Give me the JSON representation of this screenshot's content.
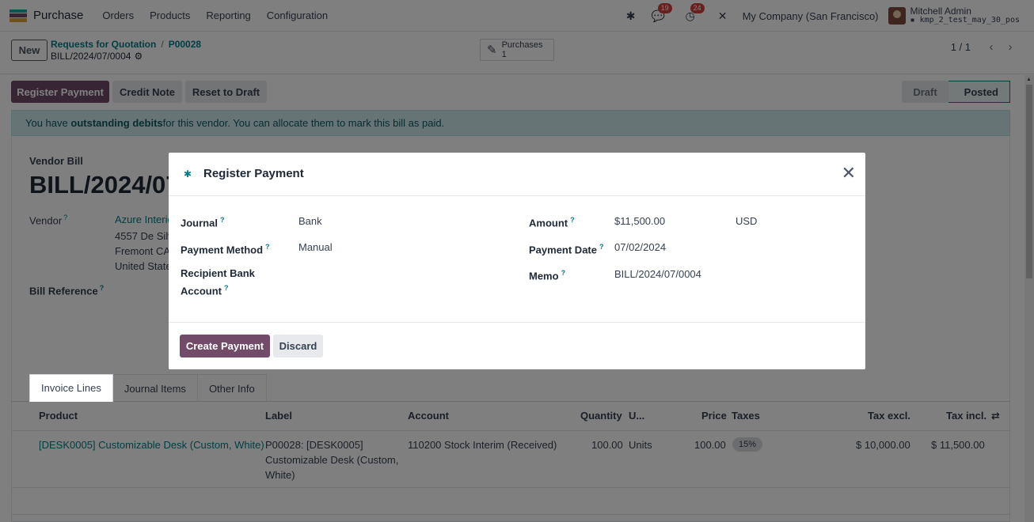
{
  "topbar": {
    "app_name": "Purchase",
    "menu": [
      "Orders",
      "Products",
      "Reporting",
      "Configuration"
    ],
    "icons": [
      "bug-icon",
      "chat-icon",
      "clock-icon",
      "tools-icon"
    ],
    "chat_count": "19",
    "activity_count": "24",
    "company": "My Company (San Francisco)",
    "user_name": "Mitchell Admin",
    "database": "kmp_2_test_may_30_pos"
  },
  "control_panel": {
    "new_label": "New",
    "breadcrumb": [
      "Requests for Quotation",
      "P00028"
    ],
    "current_record": "BILL/2024/07/0004",
    "smart_button": {
      "label": "Purchases",
      "count": "1"
    },
    "pager": "1 / 1"
  },
  "status_bar": {
    "buttons": [
      "Register Payment",
      "Credit Note",
      "Reset to Draft"
    ],
    "stages": [
      "Draft",
      "Posted"
    ],
    "active_stage": "Posted"
  },
  "alert": {
    "prefix": "You have ",
    "bold": "outstanding debits",
    "suffix": " for this vendor. You can allocate them to mark this bill as paid."
  },
  "form": {
    "type_label": "Vendor Bill",
    "name": "BILL/2024/07/0004",
    "vendor_label": "Vendor",
    "vendor_name": "Azure Interior",
    "vendor_address": [
      "4557 De Silva St",
      "Fremont CA 94538",
      "United States"
    ],
    "bill_reference_label": "Bill Reference"
  },
  "tabs": [
    "Invoice Lines",
    "Journal Items",
    "Other Info"
  ],
  "lines": {
    "columns": [
      "Product",
      "Label",
      "Account",
      "Quantity",
      "U...",
      "Price",
      "Taxes",
      "Tax excl.",
      "Tax incl."
    ],
    "rows": [
      {
        "product": "[DESK0005] Customizable Desk (Custom, White)",
        "label": [
          "P00028: [DESK0005]",
          "Customizable Desk (Custom,",
          "White)"
        ],
        "account": "110200 Stock Interim (Received)",
        "quantity": "100.00",
        "uom": "Units",
        "price": "100.00",
        "taxes": "15%",
        "tax_excl": "$ 10,000.00",
        "tax_incl": "$ 11,500.00"
      }
    ]
  },
  "modal": {
    "title": "Register Payment",
    "fields": {
      "journal": {
        "label": "Journal",
        "value": "Bank"
      },
      "payment_method": {
        "label": "Payment Method",
        "value": "Manual"
      },
      "recipient_bank": {
        "label_line1": "Recipient Bank",
        "label_line2": "Account",
        "value": ""
      },
      "amount": {
        "label": "Amount",
        "value": "$11,500.00",
        "currency": "USD"
      },
      "payment_date": {
        "label": "Payment Date",
        "value": "07/02/2024"
      },
      "memo": {
        "label": "Memo",
        "value": "BILL/2024/07/0004"
      }
    },
    "help_marker": "?",
    "create_label": "Create Payment",
    "discard_label": "Discard"
  },
  "colors": {
    "primary": "#714b67",
    "link": "#017e84",
    "alert_bg": "#cfe8ea",
    "badge": "#d23f3a"
  }
}
